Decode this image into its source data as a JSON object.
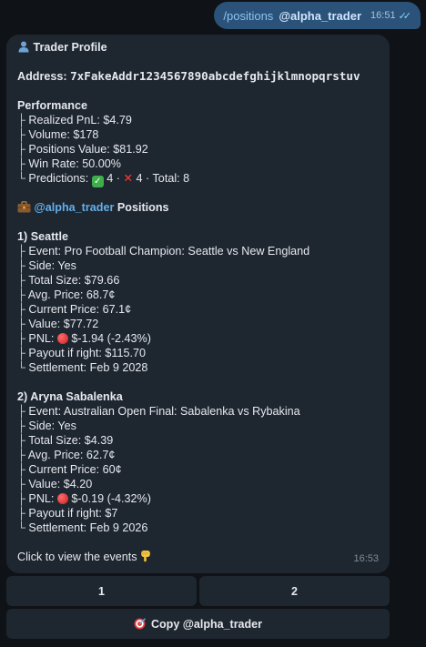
{
  "outgoing": {
    "command": "/positions",
    "mention": "@alpha_trader",
    "time": "16:51",
    "read": true
  },
  "profile": {
    "header_icon": "bust-in-silhouette-icon",
    "header": "Trader Profile",
    "address_label": "Address:",
    "address": "7xFakeAddr1234567890abcdefghijklmnopqrstuv",
    "performance_title": "Performance",
    "performance": [
      {
        "prefix": "├ ",
        "text": "Realized PnL: $4.79"
      },
      {
        "prefix": "├ ",
        "text": "Volume: $178"
      },
      {
        "prefix": "├ ",
        "text": "Positions Value: $81.92"
      },
      {
        "prefix": "├ ",
        "text": "Win Rate: 50.00%"
      }
    ],
    "predictions": {
      "prefix": "└ ",
      "label": "Predictions:",
      "wins": "4",
      "sep1": "·",
      "losses": "4",
      "sep2": "·",
      "total": "Total: 8"
    },
    "positions_icon": "briefcase-icon",
    "positions_mention": "@alpha_trader",
    "positions_title": "Positions"
  },
  "positions": [
    {
      "title": "1) Seattle",
      "event": "Event: Pro Football Champion: Seattle vs New England",
      "side": "Side: Yes",
      "total_size": "Total Size: $79.66",
      "avg_price": "Avg. Price: 68.7¢",
      "current_price": "Current Price: 67.1¢",
      "value": "Value: $77.72",
      "pnl_label": "PNL:",
      "pnl": "$-1.94 (-2.43%)",
      "payout": "Payout if right: $115.70",
      "settlement": "Settlement: Feb 9 2028"
    },
    {
      "title": "2) Aryna Sabalenka",
      "event": "Event: Australian Open Final: Sabalenka vs Rybakina",
      "side": "Side: Yes",
      "total_size": "Total Size: $4.39",
      "avg_price": "Avg. Price: 62.7¢",
      "current_price": "Current Price: 60¢",
      "value": "Value: $4.20",
      "pnl_label": "PNL:",
      "pnl": "$-0.19 (-4.32%)",
      "payout": "Payout if right: $7",
      "settlement": "Settlement: Feb 9 2026"
    }
  ],
  "footer_text": "Click to view the events",
  "footer_icon": "pointing-down-hand-icon",
  "incoming_time": "16:53",
  "keyboard": {
    "row1": [
      "1",
      "2"
    ],
    "copy_icon": "dart-target-icon",
    "copy_label": "Copy @alpha_trader"
  },
  "colors": {
    "background": "#0f1216",
    "bubble_in": "#1e2630",
    "bubble_out": "#2b5278",
    "link": "#63aee9",
    "loss_dot": "#e02a2a",
    "win_check": "#3fae4a"
  }
}
